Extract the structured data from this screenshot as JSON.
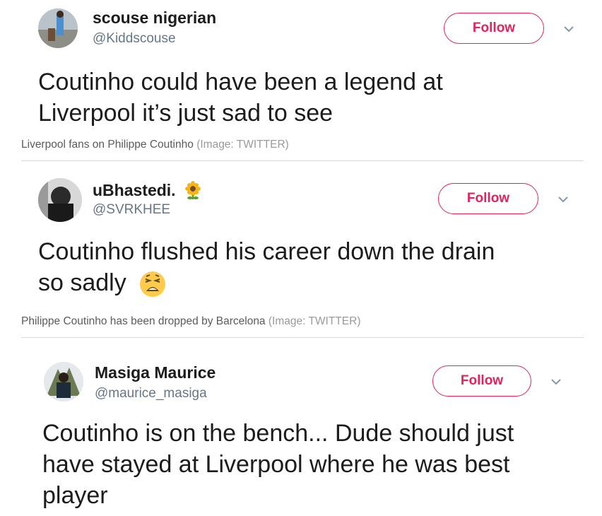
{
  "tweets": [
    {
      "name": "scouse nigerian",
      "handle": "@Kiddscouse",
      "follow_label": "Follow",
      "text_lines": [
        "Coutinho could have been a legend at",
        "Liverpool it’s just sad to see"
      ],
      "caption": "Liverpool fans on Philippe Coutinho",
      "credit": "(Image: TWITTER)"
    },
    {
      "name": "uBhastedi.",
      "name_emoji": "sunflower-icon",
      "handle": "@SVRKHEE",
      "follow_label": "Follow",
      "text_lines": [
        "Coutinho flushed his career down the drain",
        "so sadly"
      ],
      "text_emoji": "weary-face-icon",
      "caption": "Philippe Coutinho has been dropped by Barcelona",
      "credit": "(Image: TWITTER)"
    },
    {
      "name": "Masiga Maurice",
      "handle": "@maurice_masiga",
      "follow_label": "Follow",
      "text_lines": [
        "Coutinho is on the bench... Dude should just",
        "have stayed at Liverpool where he was best",
        "player"
      ]
    }
  ],
  "colors": {
    "accent": "#e0245e",
    "handle": "#657786",
    "caption": "#5b5b5b",
    "credit": "#9a9a9a"
  }
}
